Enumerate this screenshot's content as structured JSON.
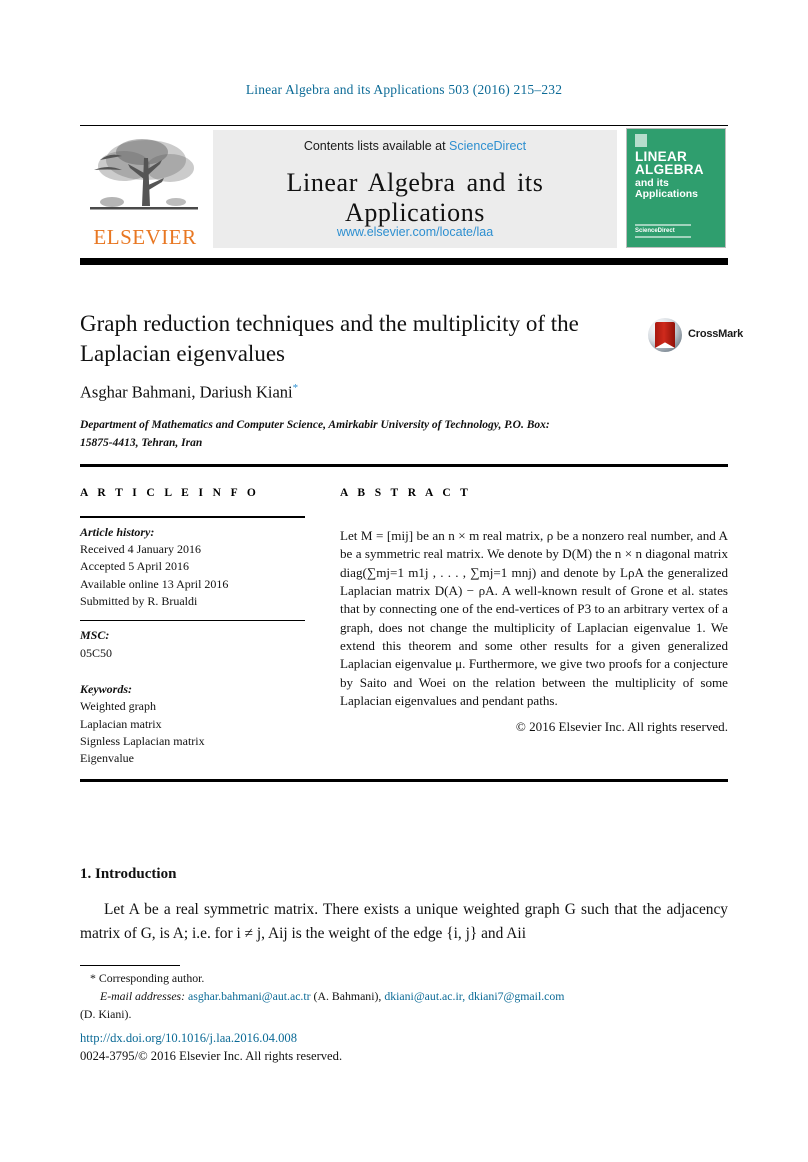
{
  "running_head": "Linear Algebra and its Applications 503 (2016) 215–232",
  "masthead": {
    "contents_prefix": "Contents lists available at ",
    "sciencedirect": "ScienceDirect",
    "journal_title": "Linear Algebra and its Applications",
    "journal_url": "www.elsevier.com/locate/laa",
    "publisher": "ELSEVIER",
    "cover": {
      "line1": "LINEAR",
      "line2": "ALGEBRA",
      "line3": "and its",
      "line4": "Applications",
      "footer_text": "ScienceDirect"
    },
    "colors": {
      "link_blue": "#2d8fd0",
      "elsevier_orange": "#E87722",
      "cover_green": "#2f9e6e",
      "panel_gray": "#ececec"
    }
  },
  "article": {
    "title": "Graph reduction techniques and the multiplicity of the Laplacian eigenvalues",
    "authors": "Asghar Bahmani, Dariush Kiani",
    "corresponding_marker": "*",
    "affiliation": "Department of Mathematics and Computer Science, Amirkabir University of Technology, P.O. Box: 15875-4413, Tehran, Iran",
    "crossmark_label": "CrossMark"
  },
  "headers": {
    "article_info": "A R T I C L E   I N F O",
    "abstract": "A B S T R A C T"
  },
  "article_info": {
    "history_label": "Article history:",
    "history": [
      "Received 4 January 2016",
      "Accepted 5 April 2016",
      "Available online 13 April 2016",
      "Submitted by R. Brualdi"
    ],
    "msc_label": "MSC:",
    "msc": [
      "05C50"
    ],
    "keywords_label": "Keywords:",
    "keywords": [
      "Weighted graph",
      "Laplacian matrix",
      "Signless Laplacian matrix",
      "Eigenvalue"
    ]
  },
  "abstract": {
    "text": "Let M = [mij] be an n × m real matrix, ρ be a nonzero real number, and A be a symmetric real matrix. We denote by D(M) the n × n diagonal matrix diag(∑mj=1 m1j , . . . , ∑mj=1 mnj) and denote by LρA the generalized Laplacian matrix D(A) − ρA. A well-known result of Grone et al. states that by connecting one of the end-vertices of P3 to an arbitrary vertex of a graph, does not change the multiplicity of Laplacian eigenvalue 1. We extend this theorem and some other results for a given generalized Laplacian eigenvalue μ. Furthermore, we give two proofs for a conjecture by Saito and Woei on the relation between the multiplicity of some Laplacian eigenvalues and pendant paths.",
    "copyright": "© 2016 Elsevier Inc. All rights reserved."
  },
  "body": {
    "section_number_title": "1.  Introduction",
    "paragraph": "Let A be a real symmetric matrix. There exists a unique weighted graph G such that the adjacency matrix of G, is A; i.e. for i ≠ j, Aij is the weight of the edge {i, j} and Aii"
  },
  "footnotes": {
    "corresponding": "*  Corresponding author.",
    "email_label": "E-mail addresses:",
    "email_1": "asghar.bahmani@aut.ac.tr",
    "email_1_name": "(A. Bahmani),",
    "email_2": "dkiani@aut.ac.ir,",
    "email_3": "dkiani7@gmail.com",
    "email_2_name": "(D. Kiani)."
  },
  "footer": {
    "doi": "http://dx.doi.org/10.1016/j.laa.2016.04.008",
    "issn_line": "0024-3795/© 2016 Elsevier Inc. All rights reserved."
  }
}
